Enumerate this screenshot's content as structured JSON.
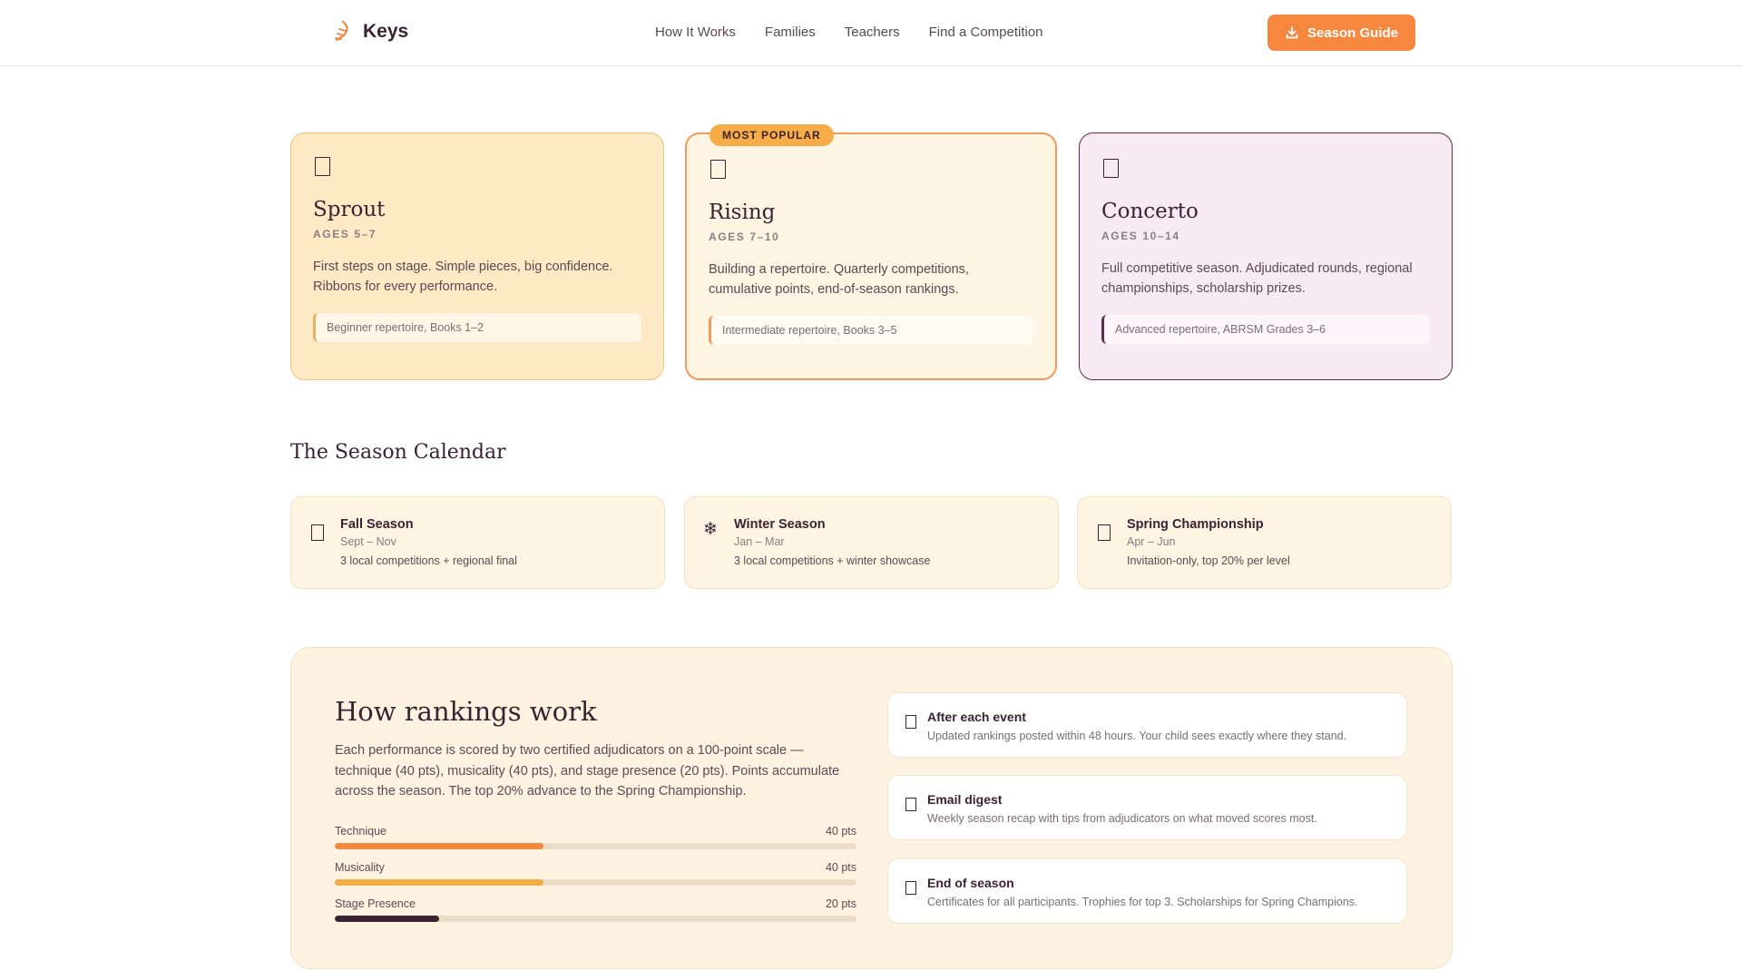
{
  "header": {
    "brand": "Keys",
    "nav": [
      "How It Works",
      "Families",
      "Teachers",
      "Find a Competition"
    ],
    "cta_label": "Season Guide"
  },
  "tiers": [
    {
      "name": "Sprout",
      "ages": "AGES 5–7",
      "description": "First steps on stage. Simple pieces, big confidence. Ribbons for every performance.",
      "repertoire": "Beginner repertoire, Books 1–2"
    },
    {
      "name": "Rising",
      "ages": "AGES 7–10",
      "badge": "MOST POPULAR",
      "description": "Building a repertoire. Quarterly competitions, cumulative points, end-of-season rankings.",
      "repertoire": "Intermediate repertoire, Books 3–5"
    },
    {
      "name": "Concerto",
      "ages": "AGES 10–14",
      "description": "Full competitive season. Adjudicated rounds, regional championships, scholarship prizes.",
      "repertoire": "Advanced repertoire, ABRSM Grades 3–6"
    }
  ],
  "calendar": {
    "title": "The Season Calendar",
    "seasons": [
      {
        "name": "Fall Season",
        "dates": "Sept – Nov",
        "note": "3 local competitions + regional final"
      },
      {
        "name": "Winter Season",
        "dates": "Jan – Mar",
        "note": "3 local competitions + winter showcase",
        "icon": "❄"
      },
      {
        "name": "Spring Championship",
        "dates": "Apr – Jun",
        "note": "Invitation-only, top 20% per level"
      }
    ]
  },
  "rankings": {
    "title": "How rankings work",
    "description": "Each performance is scored by two certified adjudicators on a 100-point scale — technique (40 pts), musicality (40 pts), and stage presence (20 pts). Points accumulate across the season. The top 20% advance to the Spring Championship.",
    "scale_max": 100,
    "criteria": [
      {
        "label": "Technique",
        "points_label": "40 pts",
        "points": 40,
        "color": "#f5873f"
      },
      {
        "label": "Musicality",
        "points_label": "40 pts",
        "points": 40,
        "color": "#f2ad45"
      },
      {
        "label": "Stage Presence",
        "points_label": "20 pts",
        "points": 20,
        "color": "#3b2233"
      }
    ],
    "updates": [
      {
        "title": "After each event",
        "text": "Updated rankings posted within 48 hours. Your child sees exactly where they stand."
      },
      {
        "title": "Email digest",
        "text": "Weekly season recap with tips from adjudicators on what moved scores most."
      },
      {
        "title": "End of season",
        "text": "Certificates for all participants. Trophies for top 3. Scholarships for Spring Champions."
      }
    ]
  }
}
